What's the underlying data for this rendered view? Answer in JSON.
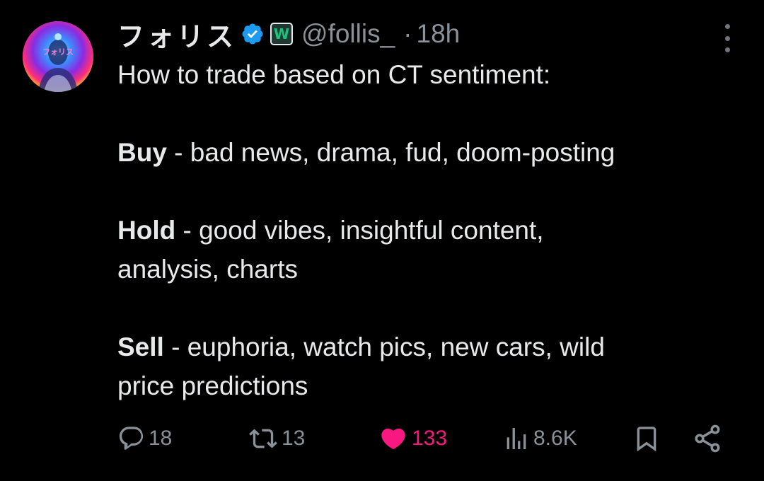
{
  "author": {
    "display_name": "フォリス",
    "handle": "@follis_",
    "separator": "·",
    "time": "18h",
    "verified": true,
    "affiliate_badge_letter": "W",
    "avatar_overlay_text": "フォリス"
  },
  "tweet": {
    "intro": "How to trade based on CT sentiment:",
    "buy_label": "Buy",
    "buy_text": " - bad news, drama, fud, doom-posting",
    "hold_label": "Hold",
    "hold_text": " - good vibes, insightful content,",
    "hold_text_2": "analysis, charts",
    "sell_label": "Sell",
    "sell_text": " - euphoria, watch pics, new cars, wild",
    "sell_text_2": "price predictions"
  },
  "actions": {
    "replies": "18",
    "retweets": "13",
    "likes": "133",
    "views": "8.6K",
    "liked": true
  },
  "colors": {
    "background": "#000000",
    "text": "#e7e9ea",
    "muted": "#8b9198",
    "verified_blue": "#1d9bf0",
    "like_pink": "#f91880"
  }
}
